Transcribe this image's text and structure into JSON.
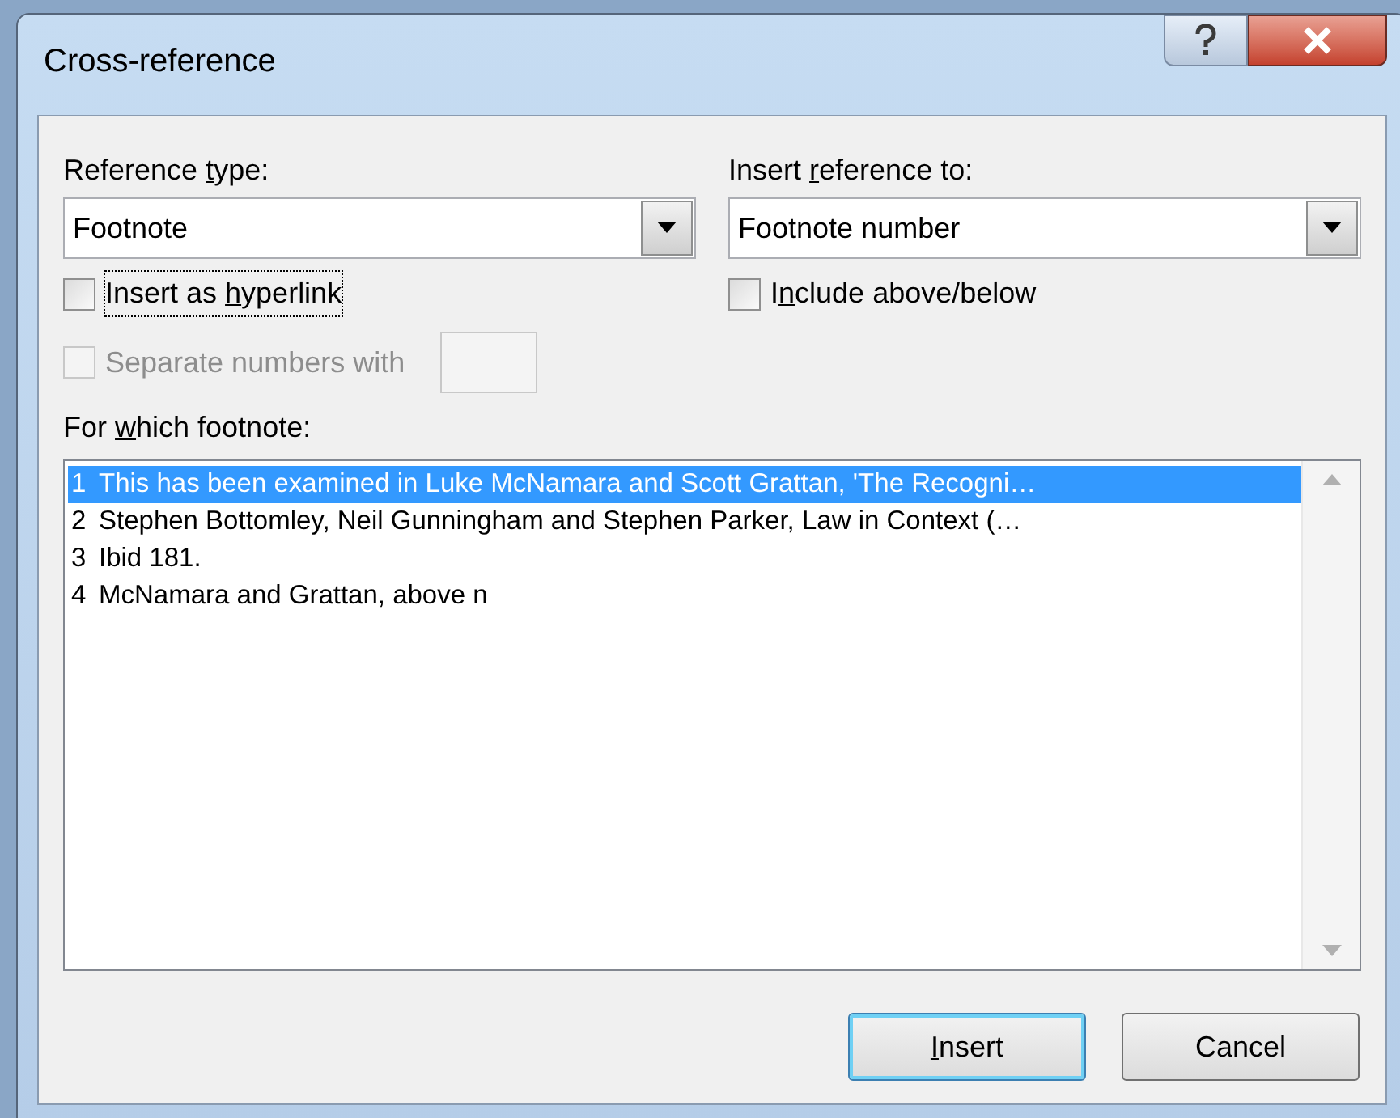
{
  "window": {
    "title": "Cross-reference"
  },
  "reference_type": {
    "label": {
      "before": "Reference ",
      "key": "t",
      "after": "ype:"
    },
    "value": "Footnote"
  },
  "insert_reference_to": {
    "label": {
      "before": "Insert ",
      "key": "r",
      "after": "eference to:"
    },
    "value": "Footnote number"
  },
  "checkboxes": [
    {
      "label": {
        "before": "Insert as ",
        "key": "h",
        "after": "yperlink"
      },
      "checked": false,
      "disabled": false,
      "focused": true
    },
    {
      "label": {
        "before": "I",
        "key": "n",
        "after": "clude above/below"
      },
      "checked": false,
      "disabled": false,
      "focused": false
    },
    {
      "label": {
        "before": "Separate numbers with"
      },
      "checked": false,
      "disabled": true,
      "focused": false
    }
  ],
  "list": {
    "label": {
      "before": "For ",
      "key": "w",
      "after": "hich footnote:"
    },
    "items": [
      {
        "number": "1",
        "text": "This has been examined in Luke McNamara and Scott Grattan, 'The Recogni…",
        "selected": true
      },
      {
        "number": "2",
        "text": "Stephen Bottomley, Neil Gunningham and Stephen Parker, Law in Context (…",
        "selected": false
      },
      {
        "number": "3",
        "text": "Ibid 181.",
        "selected": false
      },
      {
        "number": "4",
        "text": "McNamara and Grattan, above n",
        "selected": false
      }
    ]
  },
  "buttons": [
    {
      "label": {
        "key": "I",
        "after": "nsert"
      },
      "default": true
    },
    {
      "label": {
        "before": "Cancel"
      },
      "default": false
    }
  ]
}
